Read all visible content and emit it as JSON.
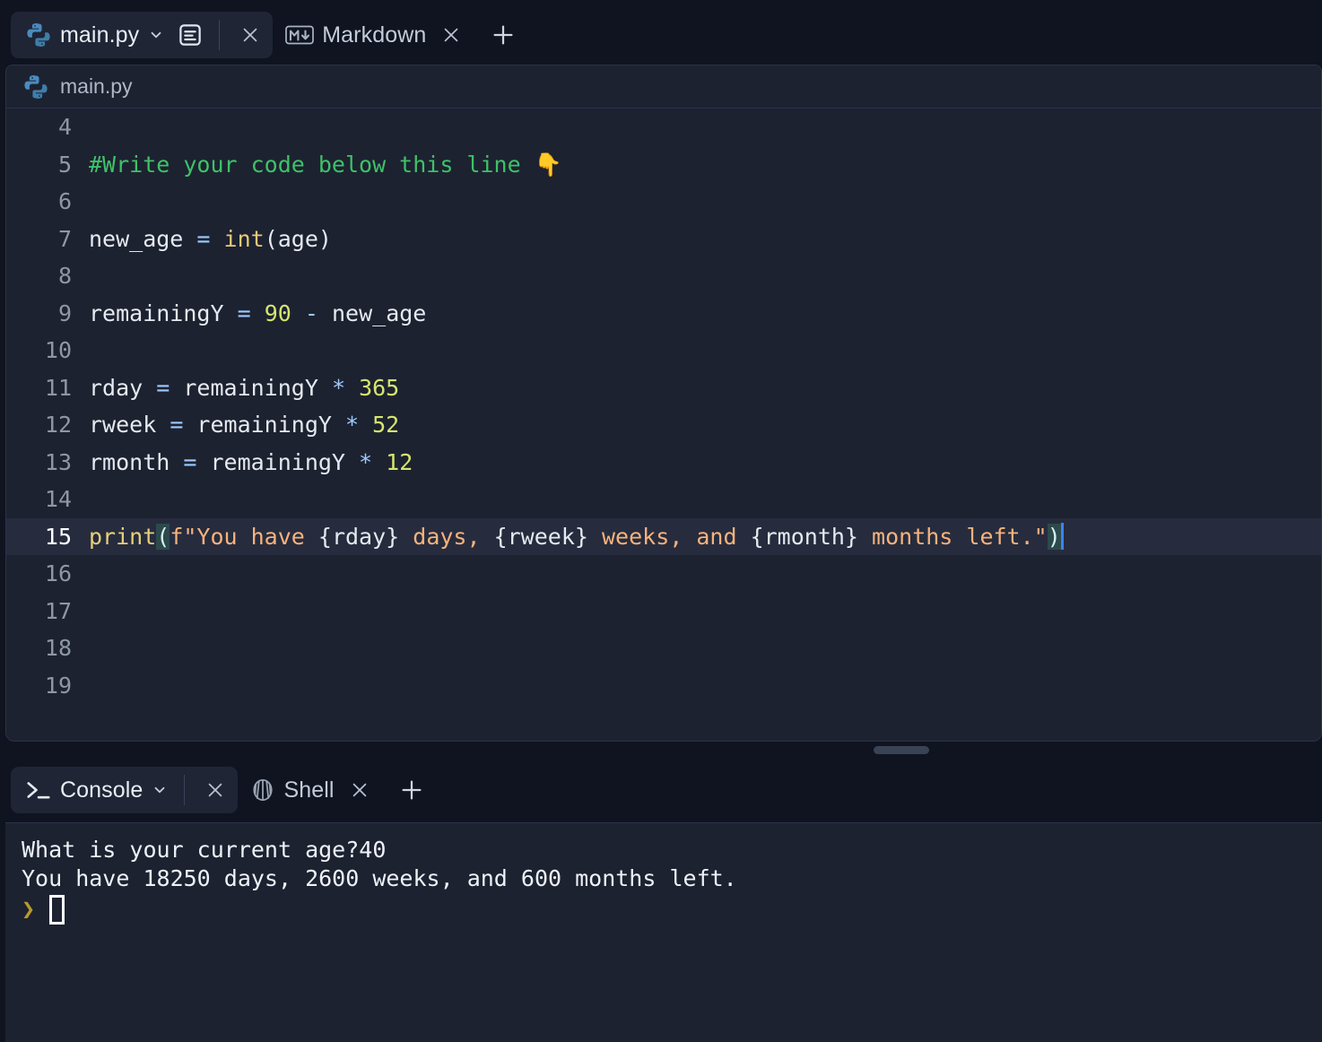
{
  "app": {
    "theme_bg": "#0f1420",
    "panel_bg": "#1d2231",
    "accent_cursor": "#3b82f6"
  },
  "editor": {
    "tabs": [
      {
        "label": "main.py",
        "icon": "python-icon",
        "active": true,
        "has_chevron": true,
        "has_doc_icon": true,
        "close": "×"
      },
      {
        "label": "Markdown",
        "icon": "markdown-icon",
        "active": false,
        "close": "×"
      }
    ],
    "new_tab_label": "+",
    "file_header": {
      "name": "main.py",
      "icon": "python-icon"
    },
    "lines": [
      {
        "num": "4",
        "active": false,
        "tokens": []
      },
      {
        "num": "5",
        "active": false,
        "tokens": [
          {
            "t": "#Write your code below this line ",
            "c": "tok-comment"
          },
          {
            "t": "👇",
            "c": "emoji"
          }
        ]
      },
      {
        "num": "6",
        "active": false,
        "tokens": []
      },
      {
        "num": "7",
        "active": false,
        "tokens": [
          {
            "t": "new_age ",
            "c": "tok-var"
          },
          {
            "t": "=",
            "c": "tok-op"
          },
          {
            "t": " ",
            "c": "tok-var"
          },
          {
            "t": "int",
            "c": "tok-kw"
          },
          {
            "t": "(age)",
            "c": "tok-punc"
          }
        ]
      },
      {
        "num": "8",
        "active": false,
        "tokens": []
      },
      {
        "num": "9",
        "active": false,
        "tokens": [
          {
            "t": "remainingY ",
            "c": "tok-var"
          },
          {
            "t": "=",
            "c": "tok-op"
          },
          {
            "t": " ",
            "c": "tok-var"
          },
          {
            "t": "90",
            "c": "tok-num"
          },
          {
            "t": " ",
            "c": "tok-var"
          },
          {
            "t": "-",
            "c": "tok-op"
          },
          {
            "t": " new_age",
            "c": "tok-var"
          }
        ]
      },
      {
        "num": "10",
        "active": false,
        "tokens": []
      },
      {
        "num": "11",
        "active": false,
        "tokens": [
          {
            "t": "rday ",
            "c": "tok-var"
          },
          {
            "t": "=",
            "c": "tok-op"
          },
          {
            "t": " remainingY ",
            "c": "tok-var"
          },
          {
            "t": "*",
            "c": "tok-op"
          },
          {
            "t": " ",
            "c": "tok-var"
          },
          {
            "t": "365",
            "c": "tok-num"
          }
        ]
      },
      {
        "num": "12",
        "active": false,
        "tokens": [
          {
            "t": "rweek ",
            "c": "tok-var"
          },
          {
            "t": "=",
            "c": "tok-op"
          },
          {
            "t": " remainingY ",
            "c": "tok-var"
          },
          {
            "t": "*",
            "c": "tok-op"
          },
          {
            "t": " ",
            "c": "tok-var"
          },
          {
            "t": "52",
            "c": "tok-num"
          }
        ]
      },
      {
        "num": "13",
        "active": false,
        "tokens": [
          {
            "t": "rmonth ",
            "c": "tok-var"
          },
          {
            "t": "=",
            "c": "tok-op"
          },
          {
            "t": " remainingY ",
            "c": "tok-var"
          },
          {
            "t": "*",
            "c": "tok-op"
          },
          {
            "t": " ",
            "c": "tok-var"
          },
          {
            "t": "12",
            "c": "tok-num"
          }
        ]
      },
      {
        "num": "14",
        "active": false,
        "tokens": []
      },
      {
        "num": "15",
        "active": true,
        "caret": true,
        "tokens": [
          {
            "t": "print",
            "c": "tok-fn"
          },
          {
            "t": "(",
            "c": "bracket-hl"
          },
          {
            "t": "f\"You have ",
            "c": "tok-str"
          },
          {
            "t": "{rday}",
            "c": "tok-punc"
          },
          {
            "t": " days, ",
            "c": "tok-str"
          },
          {
            "t": "{rweek}",
            "c": "tok-punc"
          },
          {
            "t": " weeks, and ",
            "c": "tok-str"
          },
          {
            "t": "{rmonth}",
            "c": "tok-punc"
          },
          {
            "t": " months left.\"",
            "c": "tok-str"
          },
          {
            "t": ")",
            "c": "bracket-hl"
          }
        ]
      },
      {
        "num": "16",
        "active": false,
        "tokens": []
      },
      {
        "num": "17",
        "active": false,
        "tokens": []
      },
      {
        "num": "18",
        "active": false,
        "tokens": []
      },
      {
        "num": "19",
        "active": false,
        "tokens": []
      }
    ]
  },
  "console": {
    "tabs": [
      {
        "label": "Console",
        "icon": "terminal-icon",
        "active": true,
        "has_chevron": true,
        "close": "×"
      },
      {
        "label": "Shell",
        "icon": "shell-icon",
        "active": false,
        "close": "×"
      }
    ],
    "new_tab_label": "+",
    "output": [
      "What is your current age?40",
      "You have 18250 days, 2600 weeks, and 600 months left."
    ],
    "prompt_symbol": "❯"
  }
}
